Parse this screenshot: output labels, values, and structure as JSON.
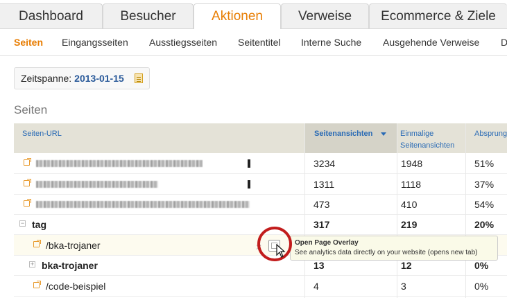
{
  "tabs": [
    {
      "label": "Dashboard"
    },
    {
      "label": "Besucher"
    },
    {
      "label": "Aktionen"
    },
    {
      "label": "Verweise"
    },
    {
      "label": "Ecommerce & Ziele"
    }
  ],
  "subnav": [
    {
      "label": "Seiten"
    },
    {
      "label": "Eingangsseiten"
    },
    {
      "label": "Ausstiegsseiten"
    },
    {
      "label": "Seitentitel"
    },
    {
      "label": "Interne Suche"
    },
    {
      "label": "Ausgehende Verweise"
    },
    {
      "label": "D"
    }
  ],
  "period": {
    "label": "Zeitspanne:",
    "date": "2013-01-15"
  },
  "page_title": "Seiten",
  "table": {
    "headers": {
      "url": "Seiten-URL",
      "views": "Seitenansichten",
      "unique_l1": "Einmalige",
      "unique_l2": "Seitenansichten",
      "bounce": "Absprung"
    },
    "rows": [
      {
        "label": "",
        "views": "3234",
        "unique": "1948",
        "bounce": "51%"
      },
      {
        "label": "",
        "views": "1311",
        "unique": "1118",
        "bounce": "37%"
      },
      {
        "label": "",
        "views": "473",
        "unique": "410",
        "bounce": "54%"
      },
      {
        "label": "tag",
        "views": "317",
        "unique": "219",
        "bounce": "20%"
      },
      {
        "label": "/bka-trojaner",
        "views": "",
        "unique": "",
        "bounce": ""
      },
      {
        "label": "bka-trojaner",
        "views": "13",
        "unique": "12",
        "bounce": "0%"
      },
      {
        "label": "/code-beispiel",
        "views": "4",
        "unique": "3",
        "bounce": "0%"
      }
    ]
  },
  "tooltip": {
    "title": "Open Page Overlay",
    "text": "See analytics data directly on your website (opens new tab)"
  },
  "icons": [
    "calendar-icon",
    "external-link-icon",
    "expand-icon",
    "collapse-icon",
    "sort-desc-icon",
    "page-overlay-icon",
    "cursor-icon"
  ]
}
